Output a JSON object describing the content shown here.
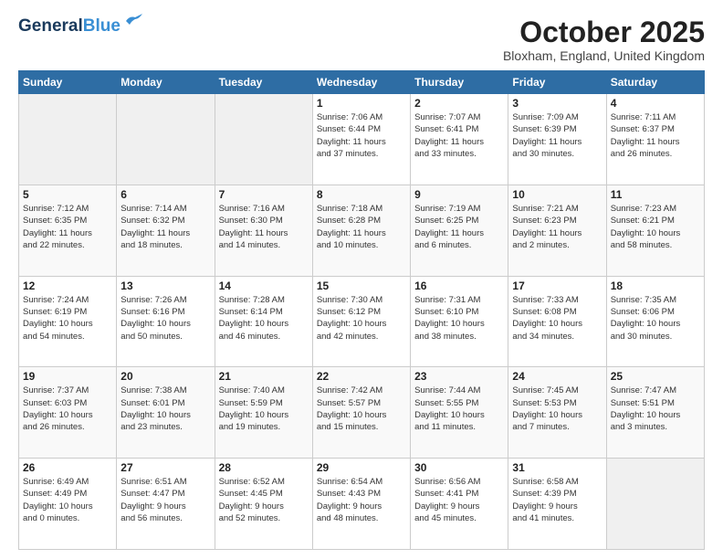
{
  "header": {
    "logo_line1": "General",
    "logo_line2": "Blue",
    "month": "October 2025",
    "location": "Bloxham, England, United Kingdom"
  },
  "weekdays": [
    "Sunday",
    "Monday",
    "Tuesday",
    "Wednesday",
    "Thursday",
    "Friday",
    "Saturday"
  ],
  "weeks": [
    [
      {
        "day": "",
        "info": ""
      },
      {
        "day": "",
        "info": ""
      },
      {
        "day": "",
        "info": ""
      },
      {
        "day": "1",
        "info": "Sunrise: 7:06 AM\nSunset: 6:44 PM\nDaylight: 11 hours\nand 37 minutes."
      },
      {
        "day": "2",
        "info": "Sunrise: 7:07 AM\nSunset: 6:41 PM\nDaylight: 11 hours\nand 33 minutes."
      },
      {
        "day": "3",
        "info": "Sunrise: 7:09 AM\nSunset: 6:39 PM\nDaylight: 11 hours\nand 30 minutes."
      },
      {
        "day": "4",
        "info": "Sunrise: 7:11 AM\nSunset: 6:37 PM\nDaylight: 11 hours\nand 26 minutes."
      }
    ],
    [
      {
        "day": "5",
        "info": "Sunrise: 7:12 AM\nSunset: 6:35 PM\nDaylight: 11 hours\nand 22 minutes."
      },
      {
        "day": "6",
        "info": "Sunrise: 7:14 AM\nSunset: 6:32 PM\nDaylight: 11 hours\nand 18 minutes."
      },
      {
        "day": "7",
        "info": "Sunrise: 7:16 AM\nSunset: 6:30 PM\nDaylight: 11 hours\nand 14 minutes."
      },
      {
        "day": "8",
        "info": "Sunrise: 7:18 AM\nSunset: 6:28 PM\nDaylight: 11 hours\nand 10 minutes."
      },
      {
        "day": "9",
        "info": "Sunrise: 7:19 AM\nSunset: 6:25 PM\nDaylight: 11 hours\nand 6 minutes."
      },
      {
        "day": "10",
        "info": "Sunrise: 7:21 AM\nSunset: 6:23 PM\nDaylight: 11 hours\nand 2 minutes."
      },
      {
        "day": "11",
        "info": "Sunrise: 7:23 AM\nSunset: 6:21 PM\nDaylight: 10 hours\nand 58 minutes."
      }
    ],
    [
      {
        "day": "12",
        "info": "Sunrise: 7:24 AM\nSunset: 6:19 PM\nDaylight: 10 hours\nand 54 minutes."
      },
      {
        "day": "13",
        "info": "Sunrise: 7:26 AM\nSunset: 6:16 PM\nDaylight: 10 hours\nand 50 minutes."
      },
      {
        "day": "14",
        "info": "Sunrise: 7:28 AM\nSunset: 6:14 PM\nDaylight: 10 hours\nand 46 minutes."
      },
      {
        "day": "15",
        "info": "Sunrise: 7:30 AM\nSunset: 6:12 PM\nDaylight: 10 hours\nand 42 minutes."
      },
      {
        "day": "16",
        "info": "Sunrise: 7:31 AM\nSunset: 6:10 PM\nDaylight: 10 hours\nand 38 minutes."
      },
      {
        "day": "17",
        "info": "Sunrise: 7:33 AM\nSunset: 6:08 PM\nDaylight: 10 hours\nand 34 minutes."
      },
      {
        "day": "18",
        "info": "Sunrise: 7:35 AM\nSunset: 6:06 PM\nDaylight: 10 hours\nand 30 minutes."
      }
    ],
    [
      {
        "day": "19",
        "info": "Sunrise: 7:37 AM\nSunset: 6:03 PM\nDaylight: 10 hours\nand 26 minutes."
      },
      {
        "day": "20",
        "info": "Sunrise: 7:38 AM\nSunset: 6:01 PM\nDaylight: 10 hours\nand 23 minutes."
      },
      {
        "day": "21",
        "info": "Sunrise: 7:40 AM\nSunset: 5:59 PM\nDaylight: 10 hours\nand 19 minutes."
      },
      {
        "day": "22",
        "info": "Sunrise: 7:42 AM\nSunset: 5:57 PM\nDaylight: 10 hours\nand 15 minutes."
      },
      {
        "day": "23",
        "info": "Sunrise: 7:44 AM\nSunset: 5:55 PM\nDaylight: 10 hours\nand 11 minutes."
      },
      {
        "day": "24",
        "info": "Sunrise: 7:45 AM\nSunset: 5:53 PM\nDaylight: 10 hours\nand 7 minutes."
      },
      {
        "day": "25",
        "info": "Sunrise: 7:47 AM\nSunset: 5:51 PM\nDaylight: 10 hours\nand 3 minutes."
      }
    ],
    [
      {
        "day": "26",
        "info": "Sunrise: 6:49 AM\nSunset: 4:49 PM\nDaylight: 10 hours\nand 0 minutes."
      },
      {
        "day": "27",
        "info": "Sunrise: 6:51 AM\nSunset: 4:47 PM\nDaylight: 9 hours\nand 56 minutes."
      },
      {
        "day": "28",
        "info": "Sunrise: 6:52 AM\nSunset: 4:45 PM\nDaylight: 9 hours\nand 52 minutes."
      },
      {
        "day": "29",
        "info": "Sunrise: 6:54 AM\nSunset: 4:43 PM\nDaylight: 9 hours\nand 48 minutes."
      },
      {
        "day": "30",
        "info": "Sunrise: 6:56 AM\nSunset: 4:41 PM\nDaylight: 9 hours\nand 45 minutes."
      },
      {
        "day": "31",
        "info": "Sunrise: 6:58 AM\nSunset: 4:39 PM\nDaylight: 9 hours\nand 41 minutes."
      },
      {
        "day": "",
        "info": ""
      }
    ]
  ]
}
